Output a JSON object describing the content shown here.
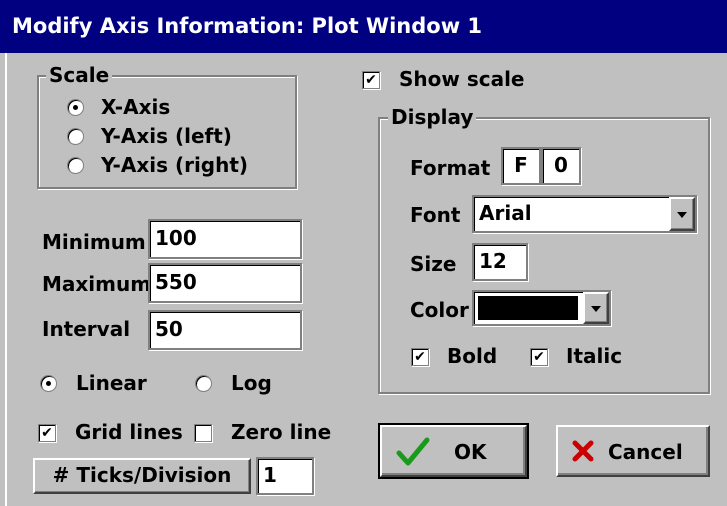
{
  "window": {
    "title": "Modify Axis Information: Plot Window 1"
  },
  "scale": {
    "legend": "Scale",
    "options": [
      {
        "label": "X-Axis",
        "selected": true
      },
      {
        "label": "Y-Axis (left)",
        "selected": false
      },
      {
        "label": "Y-Axis (right)",
        "selected": false
      }
    ]
  },
  "range": {
    "minimum_label": "Minimum",
    "minimum_value": "100",
    "maximum_label": "Maximum",
    "maximum_value": "550",
    "interval_label": "Interval",
    "interval_value": "50"
  },
  "scale_type": {
    "linear_label": "Linear",
    "linear_selected": true,
    "log_label": "Log",
    "log_selected": false
  },
  "lines": {
    "grid_label": "Grid lines",
    "grid_checked": true,
    "zero_label": "Zero line",
    "zero_checked": false
  },
  "ticks": {
    "label": "# Ticks/Division",
    "value": "1"
  },
  "show_scale": {
    "label": "Show scale",
    "checked": true
  },
  "display": {
    "legend": "Display",
    "format_label": "Format",
    "format_type": "F",
    "format_digits": "0",
    "font_label": "Font",
    "font_value": "Arial",
    "size_label": "Size",
    "size_value": "12",
    "color_label": "Color",
    "color_value": "#000000",
    "bold_label": "Bold",
    "bold_checked": true,
    "italic_label": "Italic",
    "italic_checked": true
  },
  "buttons": {
    "ok": "OK",
    "cancel": "Cancel"
  },
  "colors": {
    "titlebar": "#000080",
    "face": "#c0c0c0",
    "ok_check": "#1a9a1a",
    "cancel_x": "#cc0000"
  },
  "icons": {
    "ok": "check-icon",
    "cancel": "x-icon",
    "dropdown": "chevron-down-icon"
  }
}
